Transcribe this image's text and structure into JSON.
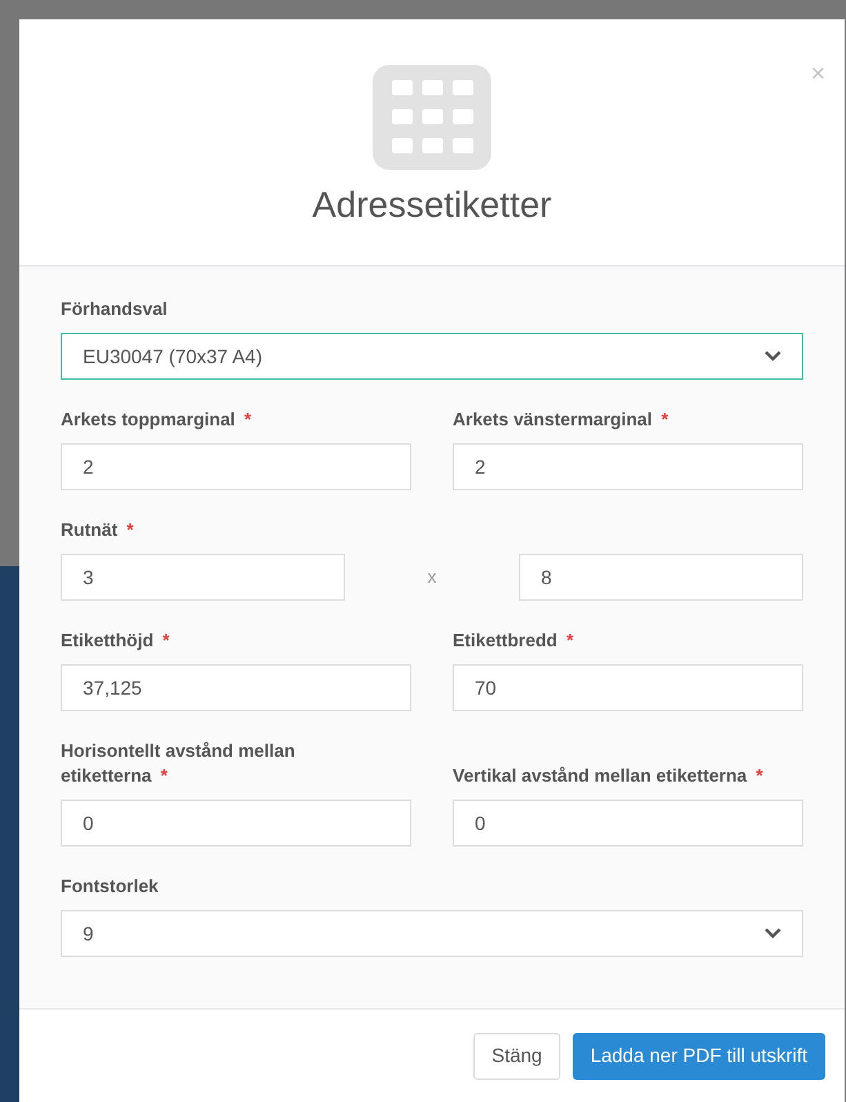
{
  "dialog": {
    "title": "Adressetiketter",
    "close": "×"
  },
  "rows": [
    {
      "kind": "single",
      "fields": [
        {
          "kind": "select",
          "label": "Förhandsval",
          "value": "EU30047 (70x37 A4)",
          "focused": true
        }
      ]
    },
    {
      "kind": "pair",
      "fields": [
        {
          "kind": "input",
          "label": "Arkets toppmarginal",
          "required": "*",
          "value": "2",
          "focused": false
        },
        {
          "kind": "input",
          "label": "Arkets vänstermarginal",
          "required": "*",
          "value": "2",
          "focused": false
        }
      ]
    },
    {
      "kind": "grid",
      "label": "Rutnät",
      "required": "*",
      "separator": "x",
      "values": [
        "3",
        "8"
      ]
    },
    {
      "kind": "pair",
      "fields": [
        {
          "kind": "input",
          "label": "Etiketthöjd",
          "required": "*",
          "value": "37,125",
          "focused": false
        },
        {
          "kind": "input",
          "label": "Etikettbredd",
          "required": "*",
          "value": "70",
          "focused": false
        }
      ]
    },
    {
      "kind": "pair",
      "fields": [
        {
          "kind": "input",
          "label": "Horisontellt avstånd mellan etiketterna",
          "required": "*",
          "value": "0",
          "focused": false
        },
        {
          "kind": "input",
          "label": "Vertikal avstånd mellan etiketterna",
          "required": "*",
          "value": "0",
          "focused": false
        }
      ]
    },
    {
      "kind": "single",
      "fields": [
        {
          "kind": "select",
          "label": "Fontstorlek",
          "value": "9",
          "focused": false
        }
      ]
    }
  ],
  "buttons": [
    {
      "label": "Stäng",
      "kind": "secondary"
    },
    {
      "label": "Ladda ner PDF till utskrift",
      "kind": "primary"
    }
  ]
}
